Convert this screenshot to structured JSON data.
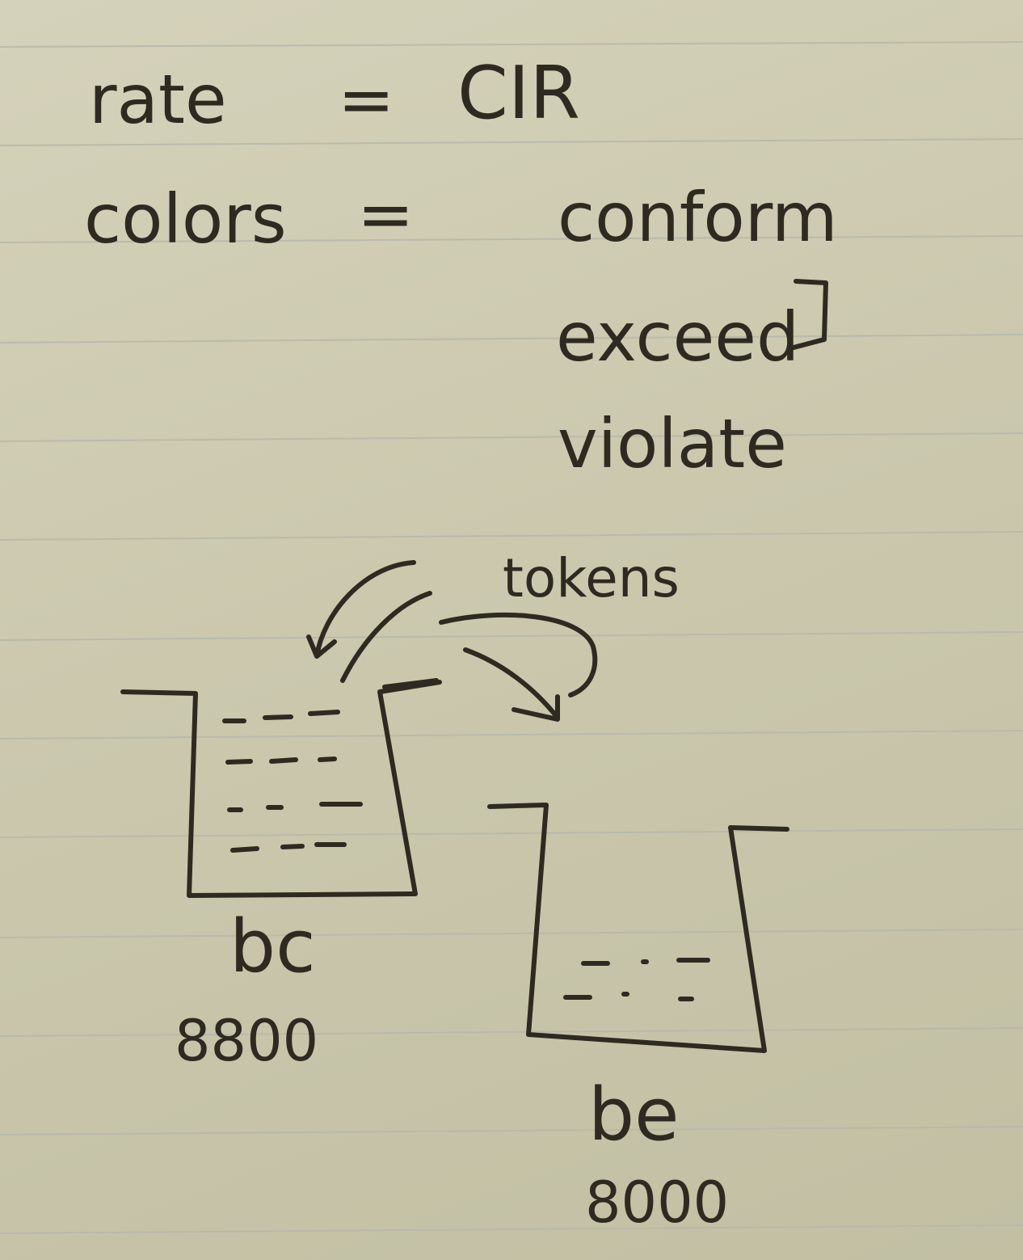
{
  "notes": {
    "line1": {
      "term": "rate",
      "equals": "=",
      "value": "CIR"
    },
    "line2": {
      "term": "colors",
      "equals": "=",
      "values": [
        "conform",
        "exceed",
        "violate"
      ]
    },
    "diagram": {
      "arrow_label": "tokens",
      "bucket_left": {
        "label": "bc",
        "value": "8800"
      },
      "bucket_right": {
        "label": "be",
        "value": "8000"
      }
    }
  },
  "colors": {
    "paper": "#cbc8ae",
    "ink": "#2f2a21",
    "rule": "#b7b9a6"
  }
}
